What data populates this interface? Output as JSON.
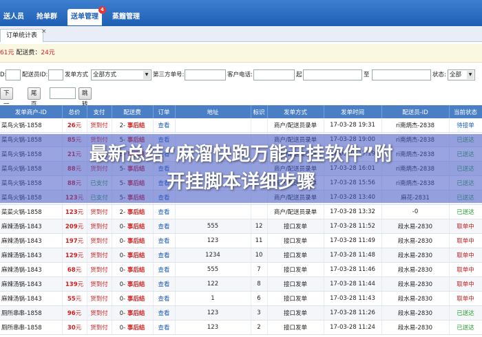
{
  "nav": {
    "tabs": [
      {
        "label": "送人员"
      },
      {
        "label": "抢单群"
      },
      {
        "label": "送单管理",
        "badge": "4"
      },
      {
        "label": "蒸餾管理"
      }
    ]
  },
  "subtab": {
    "label": "订单统计表",
    "close": "×"
  },
  "summary": {
    "prefix_value": "61元",
    "fee_label": "配送费：",
    "fee_value": "24元"
  },
  "filters": {
    "d_label": "D:",
    "courier_label": "配送员ID:",
    "method_label": "发单方式",
    "method_value": "全部方式",
    "third_label": "第三方单号:",
    "phone_label": "客户电话:",
    "from_label": "起",
    "to_label": "至",
    "status_label": "状态:",
    "status_value": "全部"
  },
  "pager": {
    "next": "下一页",
    "last": "尾页",
    "jump": "跳转"
  },
  "table": {
    "headers": [
      "发单商户-ID",
      "总价",
      "支付",
      "配送费",
      "订单",
      "地址",
      "标识",
      "发单方式",
      "发单时间",
      "配送员-ID",
      "当前状态"
    ],
    "rows": [
      [
        "菜鸟火锅-1858",
        "26元",
        "货到付",
        "2- 事后结",
        "查看",
        "",
        "",
        "商户/配送员录单",
        "17-03-28 19:31",
        "ri南炳杰-2838",
        "待接单"
      ],
      [
        "菜鸟火锅-1858",
        "85元",
        "货到付",
        "5- 事后结",
        "查看",
        "",
        "",
        "商户/配送员录单",
        "17-03-28 19:00",
        "ri南炳杰-2838",
        "已送达"
      ],
      [
        "菜鸟火锅-1858",
        "21元",
        "货到付",
        "5- 事后结",
        "查看",
        "",
        "",
        "商户/配送员录单",
        "17-03-28 17:19",
        "ri南炳杰-2838",
        "已送达"
      ],
      [
        "菜鸟火锅-1858",
        "88元",
        "货到付",
        "5- 事后结",
        "查看",
        "",
        "",
        "商户/配送员录单",
        "17-03-28 16:01",
        "ri南炳杰-2838",
        "已送达"
      ],
      [
        "菜鸟火锅-1858",
        "88元",
        "已支付",
        "5- 事后结",
        "查看",
        "",
        "",
        "商户/配送员录单",
        "17-03-28 15:56",
        "ri南炳杰-2838",
        "已送达"
      ],
      [
        "菜鸟火锅-1858",
        "123元",
        "已支付",
        "5- 事后结",
        "查看",
        "",
        "",
        "商户/配送员录单",
        "17-03-28 13:40",
        "麻花-2831",
        "已送达"
      ],
      [
        "菜菜火锅-1858",
        "123元",
        "货到付",
        "2- 事后结",
        "查看",
        "",
        "",
        "商户/配送员录单",
        "17-03-28 13:32",
        "-0",
        "已送达"
      ],
      [
        "麻辣汤锅-1843",
        "209元",
        "货到付",
        "0- 事后结",
        "查看",
        "555",
        "12",
        "接口发单",
        "17-03-28 11:52",
        "段水易-2830",
        "取单中"
      ],
      [
        "麻辣汤锅-1843",
        "197元",
        "货到付",
        "0- 事后结",
        "查看",
        "123",
        "11",
        "接口发单",
        "17-03-28 11:49",
        "段水易-2830",
        "取单中"
      ],
      [
        "麻辣汤锅-1843",
        "129元",
        "货到付",
        "0- 事后结",
        "查看",
        "1234",
        "10",
        "接口发单",
        "17-03-28 11:48",
        "段水易-2830",
        "取单中"
      ],
      [
        "麻辣汤锅-1843",
        "68元",
        "货到付",
        "0- 事后结",
        "查看",
        "555",
        "7",
        "接口发单",
        "17-03-28 11:46",
        "段水易-2830",
        "取单中"
      ],
      [
        "麻辣汤锅-1843",
        "139元",
        "货到付",
        "0- 事后结",
        "查看",
        "122",
        "8",
        "接口发单",
        "17-03-28 11:44",
        "段水易-2830",
        "取单中"
      ],
      [
        "麻辣汤锅-1843",
        "55元",
        "货到付",
        "0- 事后结",
        "查看",
        "1",
        "6",
        "接口发单",
        "17-03-28 11:43",
        "段水易-2830",
        "取单中"
      ],
      [
        "厕所串串-1858",
        "96元",
        "货到付",
        "0- 事后结",
        "查看",
        "123",
        "3",
        "接口发单",
        "17-03-28 11:26",
        "段水易-2830",
        "已送达"
      ],
      [
        "厕所串串-1858",
        "30元",
        "货到付",
        "0- 事后结",
        "查看",
        "123",
        "2",
        "接口发单",
        "17-03-28 11:24",
        "段水易-2830",
        "已送达"
      ]
    ]
  },
  "overlay": {
    "line1": "最新总结“麻溜快跑万能开挂软件”附",
    "line2": "开挂脚本详细步骤"
  },
  "colors": {
    "nav": "#1d5fb4",
    "header": "#4a7fc6",
    "overlay": "#465ac8",
    "price": "#d02020",
    "paid": "#22a22a"
  }
}
